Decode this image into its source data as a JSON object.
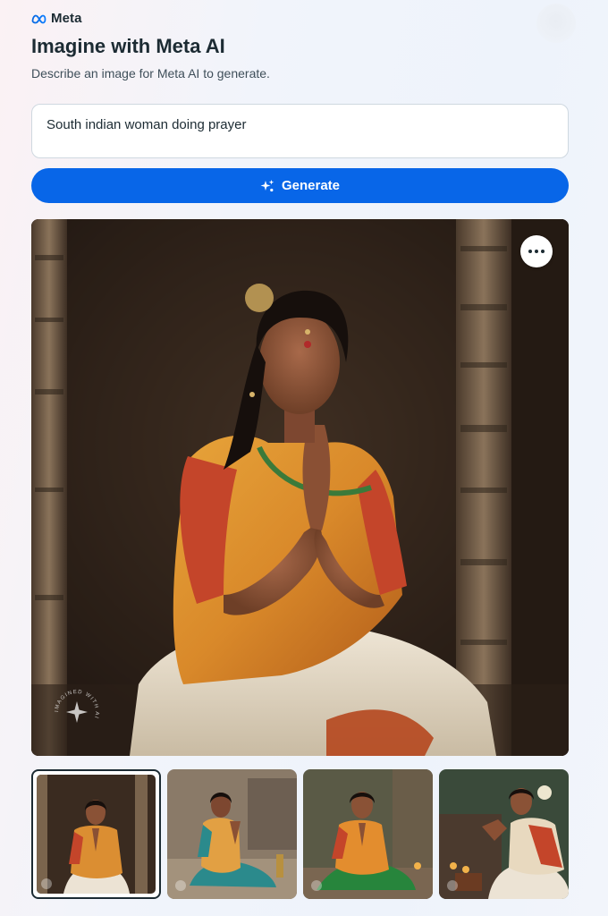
{
  "brand": {
    "logo_icon": "meta-infinity-icon",
    "name": "Meta",
    "accent": "#0866e8"
  },
  "header": {
    "title": "Imagine with Meta AI",
    "subtitle": "Describe an image for Meta AI to generate."
  },
  "prompt": {
    "value": "South indian woman doing prayer"
  },
  "generate": {
    "label": "Generate",
    "icon": "sparkle-icon"
  },
  "main_image": {
    "more_icon": "more-horizontal-icon",
    "watermark_icon": "imagined-with-ai-watermark-icon",
    "watermark_text": "IMAGINED WITH AI"
  },
  "thumbnails": [
    {
      "selected": true
    },
    {
      "selected": false
    },
    {
      "selected": false
    },
    {
      "selected": false
    }
  ]
}
